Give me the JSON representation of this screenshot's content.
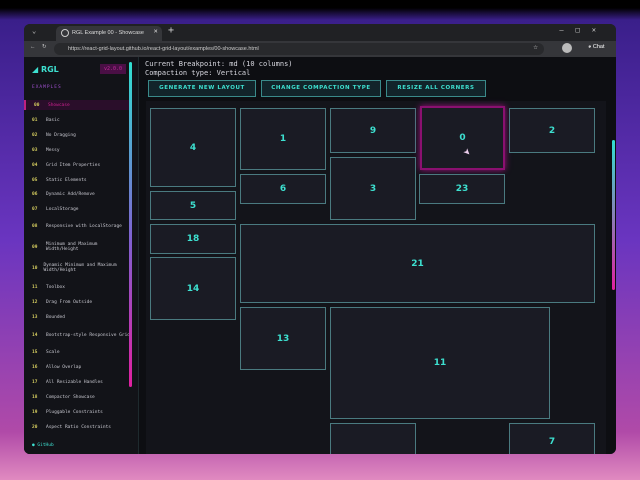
{
  "browser": {
    "tab_title": "RGL Example 00 - Showcase",
    "url": "https://react-grid-layout.github.io/react-grid-layout/examples/00-showcase.html",
    "chat_label": "Chat"
  },
  "sidebar": {
    "logo": "RGL",
    "version": "v2.0.0",
    "section": "EXAMPLES",
    "github": "GitHub",
    "items": [
      {
        "n": "00",
        "label": "Showcase"
      },
      {
        "n": "01",
        "label": "Basic"
      },
      {
        "n": "02",
        "label": "No Dragging"
      },
      {
        "n": "03",
        "label": "Messy"
      },
      {
        "n": "04",
        "label": "Grid Item Properties"
      },
      {
        "n": "05",
        "label": "Static Elements"
      },
      {
        "n": "06",
        "label": "Dynamic Add/Remove"
      },
      {
        "n": "07",
        "label": "LocalStorage"
      },
      {
        "n": "08",
        "label": "Responsive with LocalStorage"
      },
      {
        "n": "09",
        "label": "Minimum and Maximum Width/Height"
      },
      {
        "n": "10",
        "label": "Dynamic Minimum and Maximum Width/Height"
      },
      {
        "n": "11",
        "label": "Toolbox"
      },
      {
        "n": "12",
        "label": "Drag From Outside"
      },
      {
        "n": "13",
        "label": "Bounded"
      },
      {
        "n": "14",
        "label": "Bootstrap-style Responsive Grid"
      },
      {
        "n": "15",
        "label": "Scale"
      },
      {
        "n": "16",
        "label": "Allow Overlap"
      },
      {
        "n": "17",
        "label": "All Resizable Handles"
      },
      {
        "n": "18",
        "label": "Compactor Showcase"
      },
      {
        "n": "19",
        "label": "Pluggable Constraints"
      },
      {
        "n": "20",
        "label": "Aspect Ratio Constraints"
      }
    ]
  },
  "main": {
    "breakpoint": "Current Breakpoint: md (10 columns)",
    "compaction": "Compaction type: Vertical",
    "buttons": [
      "GENERATE NEW LAYOUT",
      "CHANGE COMPACTION TYPE",
      "RESIZE ALL CORNERS"
    ],
    "grid_items": [
      "4",
      "1",
      "9",
      "0",
      "2",
      "6",
      "3",
      "23",
      "5",
      "18",
      "21",
      "14",
      "13",
      "11",
      "",
      "7"
    ]
  }
}
